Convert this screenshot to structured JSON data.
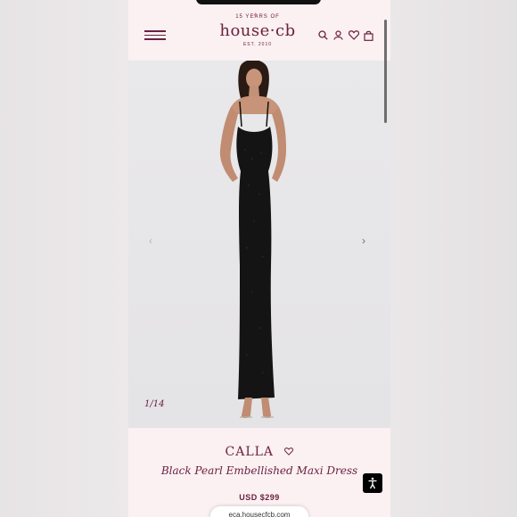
{
  "header": {
    "logo": {
      "top_text": "15 YEARS OF",
      "brand": "house·cb",
      "bottom_text": "EST. 2010"
    },
    "icons": [
      "menu-icon",
      "search-icon",
      "account-icon",
      "wishlist-icon",
      "bag-icon"
    ]
  },
  "gallery": {
    "counter": "1/14",
    "prev_glyph": "‹",
    "next_glyph": "›"
  },
  "product": {
    "name": "CALLA",
    "subtitle": "Black Pearl Embellished Maxi Dress",
    "price": "USD $299"
  },
  "browser": {
    "url": "eca.housecfcb.com"
  },
  "colors": {
    "brand": "#6b2140",
    "header_bg": "#fbf0f2",
    "photo_bg": "#e6e5e7",
    "dress": "#141414"
  }
}
